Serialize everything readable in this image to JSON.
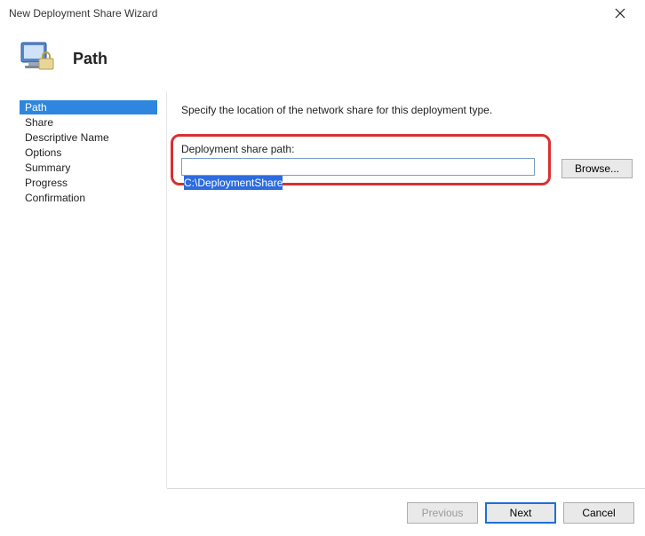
{
  "window": {
    "title": "New Deployment Share Wizard"
  },
  "header": {
    "title": "Path"
  },
  "sidebar": {
    "steps": [
      {
        "label": "Path",
        "selected": true
      },
      {
        "label": "Share",
        "selected": false
      },
      {
        "label": "Descriptive Name",
        "selected": false
      },
      {
        "label": "Options",
        "selected": false
      },
      {
        "label": "Summary",
        "selected": false
      },
      {
        "label": "Progress",
        "selected": false
      },
      {
        "label": "Confirmation",
        "selected": false
      }
    ]
  },
  "content": {
    "instruction": "Specify the location of the network share for this deployment type.",
    "field_label": "Deployment share path:",
    "path_value": "C:\\DeploymentShare",
    "browse_label": "Browse..."
  },
  "footer": {
    "previous_label": "Previous",
    "next_label": "Next",
    "cancel_label": "Cancel",
    "previous_enabled": false
  }
}
